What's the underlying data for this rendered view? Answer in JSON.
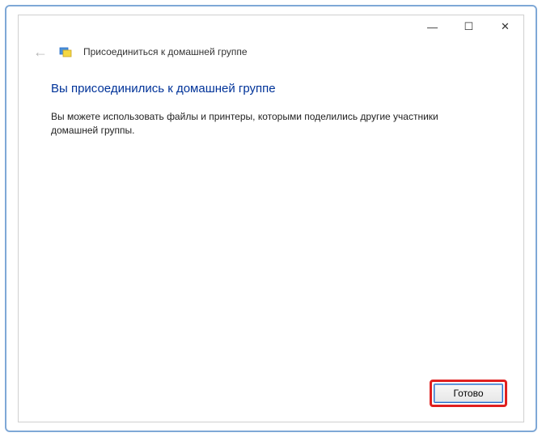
{
  "window": {
    "title": "Присоединиться к домашней группе"
  },
  "content": {
    "heading": "Вы присоединились к домашней группе",
    "body": "Вы можете использовать файлы и принтеры, которыми поделились другие участники домашней группы."
  },
  "footer": {
    "done_label": "Готово"
  },
  "controls": {
    "minimize": "—",
    "maximize": "☐",
    "close": "✕"
  }
}
